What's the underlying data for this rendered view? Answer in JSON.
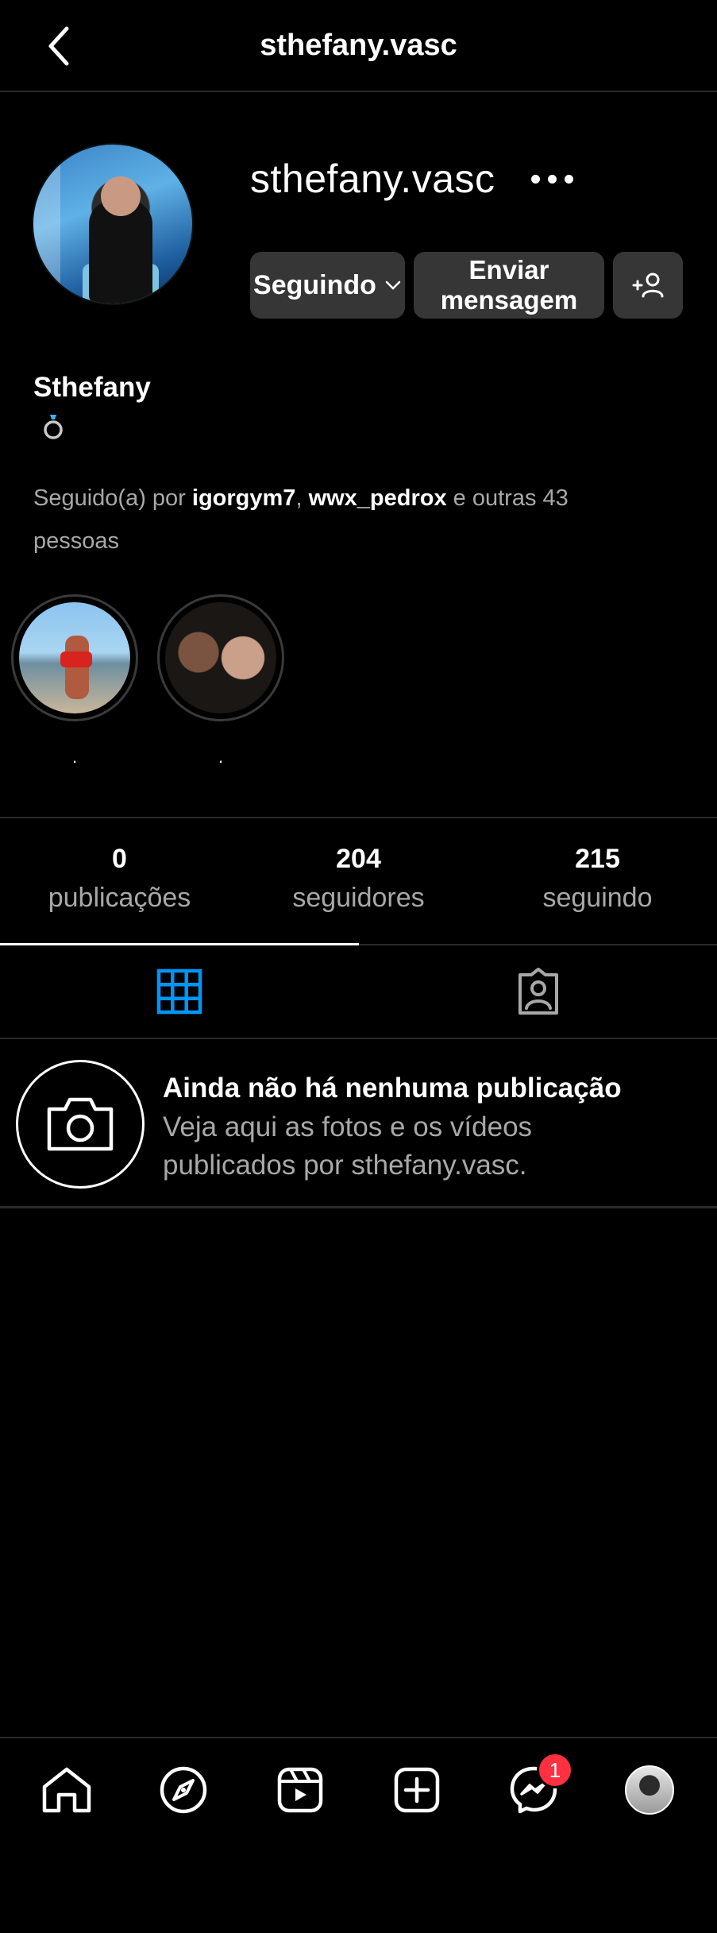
{
  "header": {
    "title": "sthefany.vasc"
  },
  "profile": {
    "username": "sthefany.vasc",
    "display_name": "Sthefany",
    "bio_icon": "ring-emoji-icon",
    "buttons": {
      "following_label": "Seguindo",
      "message_line1": "Enviar",
      "message_line2": "mensagem"
    },
    "followed_by": {
      "prefix": "Seguido(a) por ",
      "user1": "igorgym7",
      "separator": ", ",
      "user2": "wwx_pedrox",
      "suffix": " e outras 43 pessoas"
    }
  },
  "highlights": [
    {
      "label": "."
    },
    {
      "label": "."
    }
  ],
  "stats": {
    "posts": {
      "count": "0",
      "label": "publicações"
    },
    "followers": {
      "count": "204",
      "label": "seguidores"
    },
    "following": {
      "count": "215",
      "label": "seguindo"
    }
  },
  "tabs": [
    {
      "name": "grid-icon",
      "active": true
    },
    {
      "name": "tagged-icon",
      "active": false
    }
  ],
  "empty_state": {
    "title": "Ainda não há nenhuma publicação",
    "description": "Veja aqui as fotos e os vídeos publicados por sthefany.vasc."
  },
  "bottom_nav": {
    "items": [
      "home-icon",
      "explore-icon",
      "reels-icon",
      "create-icon",
      "messenger-icon",
      "profile-avatar"
    ],
    "messenger_badge": "1"
  },
  "colors": {
    "background": "#000000",
    "button": "#363636",
    "accent_blue": "#0095f6",
    "muted_text": "#a8a8a8",
    "badge_red": "#ff3040"
  }
}
